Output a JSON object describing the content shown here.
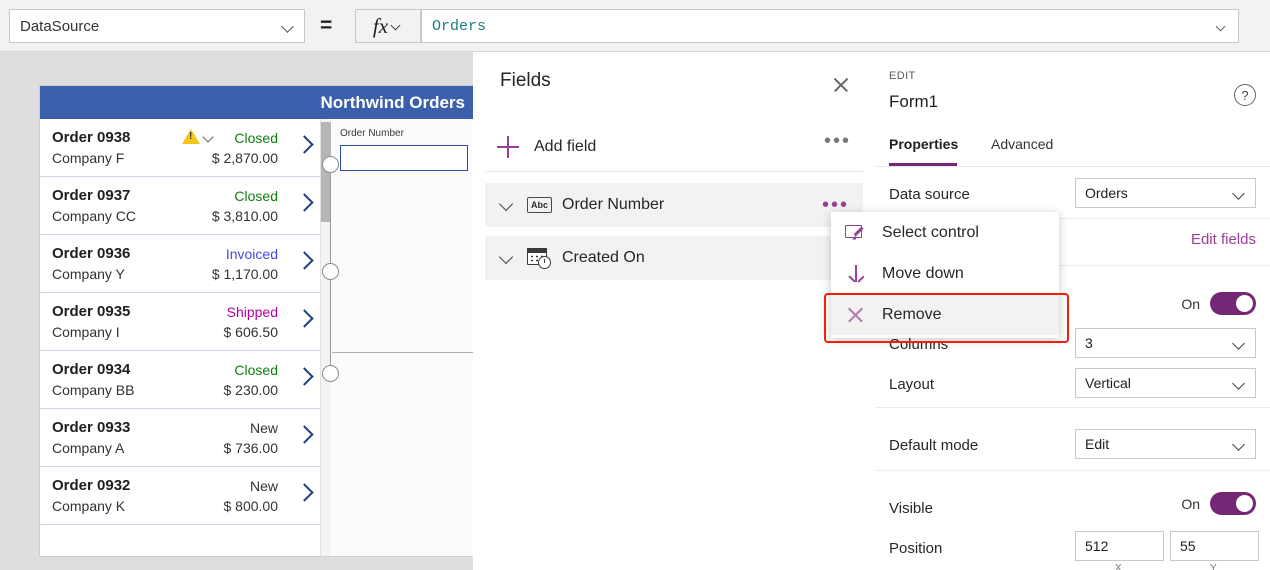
{
  "formula_bar": {
    "property_selector": "DataSource",
    "equals": "=",
    "fx_label": "fx",
    "formula_value": "Orders"
  },
  "canvas": {
    "app_title": "Northwind Orders",
    "form_field_label": "Order Number",
    "form_field_value": "",
    "gallery": [
      {
        "order": "Order 0938",
        "company": "Company F",
        "status": "Closed",
        "status_color": "#107c10",
        "amount": "$ 2,870.00",
        "warning": true
      },
      {
        "order": "Order 0937",
        "company": "Company CC",
        "status": "Closed",
        "status_color": "#107c10",
        "amount": "$ 3,810.00",
        "warning": false
      },
      {
        "order": "Order 0936",
        "company": "Company Y",
        "status": "Invoiced",
        "status_color": "#4a4ae0",
        "amount": "$ 1,170.00",
        "warning": false
      },
      {
        "order": "Order 0935",
        "company": "Company I",
        "status": "Shipped",
        "status_color": "#b4009e",
        "amount": "$ 606.50",
        "warning": false
      },
      {
        "order": "Order 0934",
        "company": "Company BB",
        "status": "Closed",
        "status_color": "#107c10",
        "amount": "$ 230.00",
        "warning": false
      },
      {
        "order": "Order 0933",
        "company": "Company A",
        "status": "New",
        "status_color": "#333333",
        "amount": "$ 736.00",
        "warning": false
      },
      {
        "order": "Order 0932",
        "company": "Company K",
        "status": "New",
        "status_color": "#333333",
        "amount": "$ 800.00",
        "warning": false
      }
    ]
  },
  "fields_panel": {
    "title": "Fields",
    "add_field_label": "Add field",
    "overflow_dots": "•••",
    "fields": [
      {
        "label": "Order Number",
        "icon": "abc-icon"
      },
      {
        "label": "Created On",
        "icon": "calendar-clock-icon"
      }
    ]
  },
  "context_menu": {
    "items": [
      {
        "label": "Select control",
        "icon": "select-control-icon"
      },
      {
        "label": "Move down",
        "icon": "arrow-down-icon"
      },
      {
        "label": "Remove",
        "icon": "close-x-icon"
      }
    ],
    "highlight_color": "#f71d0b"
  },
  "properties_panel": {
    "eyebrow": "EDIT",
    "control_name": "Form1",
    "help_glyph": "?",
    "tabs": [
      {
        "label": "Properties",
        "active": true
      },
      {
        "label": "Advanced",
        "active": false
      }
    ],
    "rows": {
      "data_source_label": "Data source",
      "data_source_value": "Orders",
      "edit_fields_link": "Edit fields",
      "snap_toggle_label": "On",
      "columns_label": "Columns",
      "columns_value": "3",
      "layout_label": "Layout",
      "layout_value": "Vertical",
      "default_mode_label": "Default mode",
      "default_mode_value": "Edit",
      "visible_label": "Visible",
      "visible_toggle_label": "On",
      "position_label": "Position",
      "position_x": "512",
      "position_y": "55",
      "axis_x_label": "X",
      "axis_y_label": "Y"
    }
  }
}
